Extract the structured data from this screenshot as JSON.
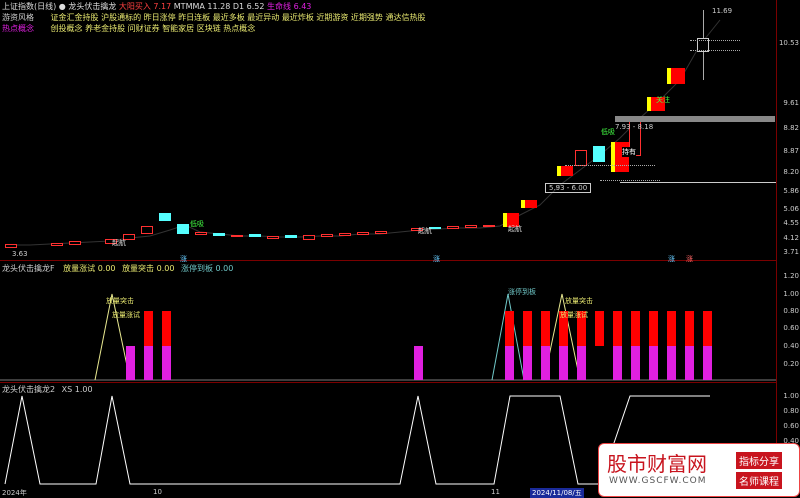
{
  "header": {
    "title": "上证指数(日线)",
    "indicator": "龙头伏击擒龙",
    "signal_label": "大阳买入",
    "signal_value": "7.17",
    "ma_label": "MTMMA",
    "ma_value": "11.28",
    "d1_label": "D1",
    "d1_value": "6.52",
    "d2_label": "生命线",
    "d2_value": "6.43"
  },
  "row2": {
    "label": "游资风格",
    "items": [
      "证金汇金持股",
      "沪股通标的",
      "昨日涨停",
      "昨日连板",
      "最近多板",
      "最近异动",
      "最近炸板",
      "近期游资",
      "近期强势",
      "通达信热股"
    ]
  },
  "row3": {
    "label": "热点概念",
    "items": [
      "创投概念",
      "养老金持股",
      "问财证券",
      "智能家居",
      "区块链",
      "热点概念"
    ]
  },
  "main_axis": [
    "11.69",
    "10.53",
    "9.61",
    "8.82",
    "8.87",
    "8.20",
    "5.86",
    "5.06",
    "4.55",
    "4.12",
    "3.71"
  ],
  "annotations": {
    "top_price": "11.69",
    "low_price": "3.63",
    "range1": "5.93 - 6.00",
    "range2": "7.93 - 8.18",
    "tag_buy": "低吸",
    "tag_hold": "持有",
    "tag_attack": "起航",
    "tag_mark": "关注"
  },
  "bottom_markers": [
    "涨",
    "涨",
    "涨",
    "涨"
  ],
  "sub1": {
    "title": "龙头伏击擒龙F",
    "f1_label": "放量涨试",
    "f1_value": "0.00",
    "f2_label": "放量突击",
    "f2_value": "0.00",
    "f3_label": "涨停到板",
    "f3_value": "0.00",
    "note1": "放量突击",
    "note2": "放量涨试",
    "note3": "涨停到板",
    "note4": "放量突击",
    "note5": "放量涨试",
    "axis": [
      "1.20",
      "1.00",
      "0.80",
      "0.60",
      "0.40",
      "0.20"
    ]
  },
  "sub2": {
    "title": "龙头伏击擒龙2",
    "xs_label": "XS",
    "xs_value": "1.00",
    "axis": [
      "1.00",
      "0.80",
      "0.60",
      "0.40"
    ]
  },
  "xaxis": {
    "year": "2024年",
    "m10": "10",
    "m11": "11",
    "cursor_date": "2024/11/08/五"
  },
  "watermark": {
    "title": "股市财富网",
    "url": "WWW.GSCFW.COM",
    "tag1": "指标分享",
    "tag2": "名师课程"
  },
  "colors": {
    "up": "#ff3030",
    "down": "#55ffff",
    "magenta": "#e020e0",
    "red_bar": "#ff0000",
    "yellow_line": "#e8e890",
    "cyan_line": "#70c8c8"
  }
}
